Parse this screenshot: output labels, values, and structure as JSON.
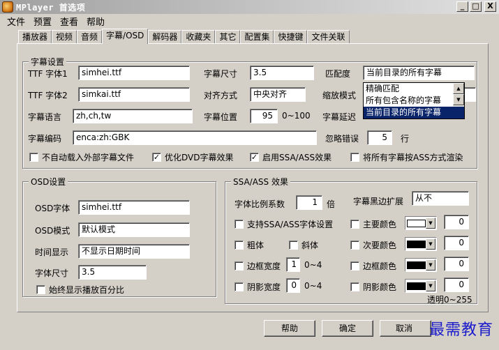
{
  "window": {
    "title": "MPlayer 首选项",
    "minimize": "_",
    "maximize": "□",
    "close": "X"
  },
  "menu": [
    "文件",
    "预置",
    "查看",
    "帮助"
  ],
  "tabs": [
    "播放器",
    "视频",
    "音频",
    "字幕/OSD",
    "解码器",
    "收藏夹",
    "其它",
    "配置集",
    "快捷键",
    "文件关联"
  ],
  "subtitle": {
    "group_title": "字幕设置",
    "ttf1_label": "TTF 字体1",
    "ttf1_value": "simhei.ttf",
    "ttf2_label": "TTF 字体2",
    "ttf2_value": "simkai.ttf",
    "lang_label": "字幕语言",
    "lang_value": "zh,ch,tw",
    "encoding_label": "字幕编码",
    "encoding_value": "enca:zh:GBK",
    "size_label": "字幕尺寸",
    "size_value": "3.5",
    "align_label": "对齐方式",
    "align_value": "中央对齐",
    "pos_label": "字幕位置",
    "pos_value": "95",
    "pos_range": "0~100",
    "match_label": "匹配度",
    "match_value": "当前目录的所有字幕",
    "match_options": [
      "精确匹配",
      "所有包含名称的字幕",
      "当前目录的所有字幕"
    ],
    "scale_label": "缩放模式",
    "delay_label": "字幕延迟",
    "ignore_label": "忽略错误",
    "ignore_value": "5",
    "ignore_unit": "行",
    "opt_no_autoload": "不自动载入外部字幕文件",
    "opt_dvd": "优化DVD字幕效果",
    "opt_ssa": "启用SSA/ASS效果",
    "opt_render_ass": "将所有字幕按ASS方式渲染",
    "checked_mark": "✓"
  },
  "osd": {
    "group_title": "OSD设置",
    "font_label": "OSD字体",
    "font_value": "simhei.ttf",
    "mode_label": "OSD模式",
    "mode_value": "默认模式",
    "time_label": "时间显示",
    "time_value": "不显示日期时间",
    "size_label": "字体尺寸",
    "size_value": "3.5",
    "percent_label": "始终显示播放百分比"
  },
  "ssa": {
    "group_title": "SSA/ASS 效果",
    "scale_label": "字体比例系数",
    "scale_value": "1",
    "scale_unit": "倍",
    "border_expand_label": "字幕黑边扩展",
    "border_expand_value": "从不",
    "font_setting": "支持SSA/ASS字体设置",
    "bold": "粗体",
    "italic": "斜体",
    "border_width_label": "边框宽度",
    "border_width_value": "1",
    "border_width_range": "0~4",
    "shadow_width_label": "阴影宽度",
    "shadow_width_value": "0",
    "shadow_width_range": "0~4",
    "primary_color": "主要颜色",
    "secondary_color": "次要颜色",
    "border_color": "边框颜色",
    "shadow_color": "阴影颜色",
    "alpha_values": [
      "0",
      "0",
      "0",
      "0"
    ],
    "alpha_hint": "透明0~255",
    "swatch_colors": [
      "#ffffff",
      "#000000",
      "#000000",
      "#000000"
    ]
  },
  "buttons": {
    "help": "帮助",
    "ok": "确定",
    "cancel": "取消"
  },
  "watermark": "最需教育"
}
